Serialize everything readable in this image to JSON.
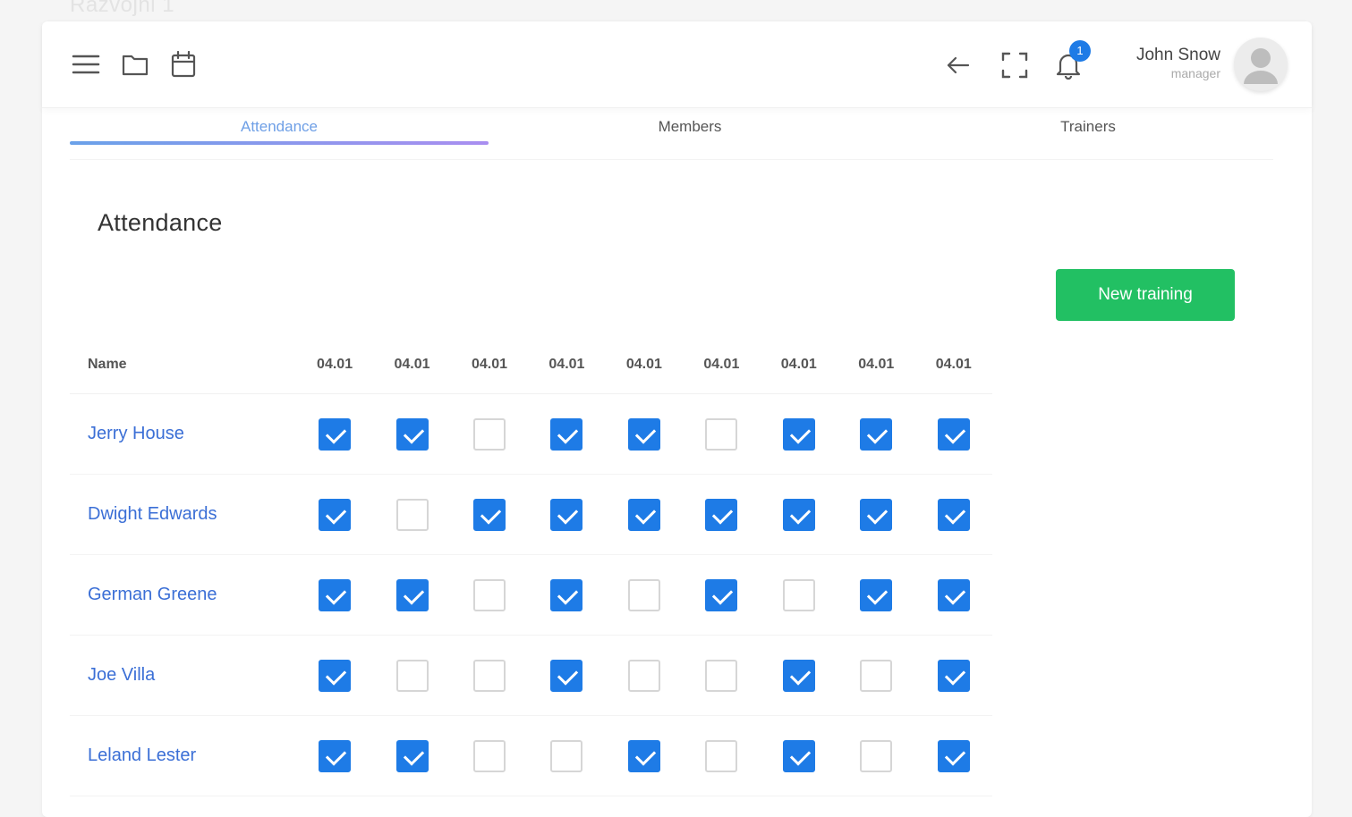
{
  "page": {
    "background_title": "Razvojni 1"
  },
  "topbar": {
    "icons": {
      "menu": "menu-icon",
      "folder": "folder-icon",
      "calendar": "calendar-icon",
      "back": "arrow-left-icon",
      "fullscreen": "fullscreen-icon",
      "bell": "bell-icon"
    },
    "notification_count": "1",
    "user": {
      "name": "John Snow",
      "role": "manager"
    }
  },
  "tabs": [
    {
      "label": "Attendance",
      "active": true
    },
    {
      "label": "Members",
      "active": false
    },
    {
      "label": "Trainers",
      "active": false
    }
  ],
  "main": {
    "title": "Attendance",
    "new_training_label": "New training",
    "table": {
      "name_header": "Name",
      "dates": [
        "04.01",
        "04.01",
        "04.01",
        "04.01",
        "04.01",
        "04.01",
        "04.01",
        "04.01",
        "04.01"
      ],
      "rows": [
        {
          "name": "Jerry House",
          "attendance": [
            true,
            true,
            false,
            true,
            true,
            false,
            true,
            true,
            true
          ]
        },
        {
          "name": "Dwight Edwards",
          "attendance": [
            true,
            false,
            true,
            true,
            true,
            true,
            true,
            true,
            true
          ]
        },
        {
          "name": "German Greene",
          "attendance": [
            true,
            true,
            false,
            true,
            false,
            true,
            false,
            true,
            true
          ]
        },
        {
          "name": "Joe Villa",
          "attendance": [
            true,
            false,
            false,
            true,
            false,
            false,
            true,
            false,
            true
          ]
        },
        {
          "name": "Leland Lester",
          "attendance": [
            true,
            true,
            false,
            false,
            true,
            false,
            true,
            false,
            true
          ]
        }
      ]
    }
  },
  "colors": {
    "accent": "#1e7be6",
    "link": "#3b6fd6",
    "button": "#22c063",
    "tab_active": "#6e9fe6"
  }
}
